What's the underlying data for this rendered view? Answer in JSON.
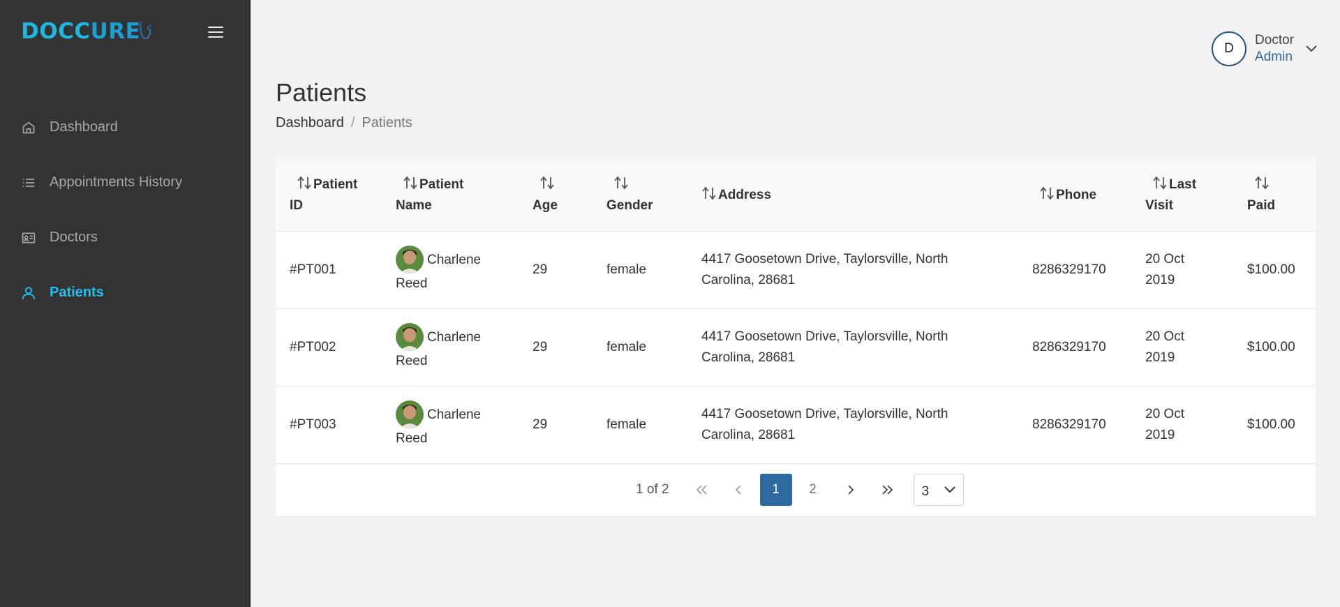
{
  "logo": {
    "text_a": "DOCC",
    "text_b": "URE"
  },
  "sidebar": {
    "items": [
      {
        "label": "Dashboard",
        "icon": "home-icon",
        "active": false
      },
      {
        "label": "Appointments History",
        "icon": "list-icon",
        "active": false
      },
      {
        "label": "Doctors",
        "icon": "id-card-icon",
        "active": false
      },
      {
        "label": "Patients",
        "icon": "user-icon",
        "active": true
      }
    ]
  },
  "header": {
    "user_initial": "D",
    "user_name": "Doctor",
    "user_role": "Admin"
  },
  "page": {
    "title": "Patients",
    "breadcrumb_home": "Dashboard",
    "breadcrumb_sep": "/",
    "breadcrumb_current": "Patients"
  },
  "table": {
    "columns": [
      {
        "line1": "Patient",
        "line2": "ID"
      },
      {
        "line1": "Patient",
        "line2": "Name"
      },
      {
        "line1": "",
        "line2": "Age"
      },
      {
        "line1": "",
        "line2": "Gender"
      },
      {
        "line1": "Address",
        "line2": ""
      },
      {
        "line1": "Phone",
        "line2": ""
      },
      {
        "line1": "Last",
        "line2": "Visit"
      },
      {
        "line1": "",
        "line2": "Paid"
      }
    ],
    "rows": [
      {
        "id": "#PT001",
        "name_first": "Charlene",
        "name_last": "Reed",
        "age": "29",
        "gender": "female",
        "address_1": "4417 Goosetown Drive, Taylorsville, North",
        "address_2": "Carolina, 28681",
        "phone": "8286329170",
        "visit_1": "20 Oct",
        "visit_2": "2019",
        "paid": "$100.00"
      },
      {
        "id": "#PT002",
        "name_first": "Charlene",
        "name_last": "Reed",
        "age": "29",
        "gender": "female",
        "address_1": "4417 Goosetown Drive, Taylorsville, North",
        "address_2": "Carolina, 28681",
        "phone": "8286329170",
        "visit_1": "20 Oct",
        "visit_2": "2019",
        "paid": "$100.00"
      },
      {
        "id": "#PT003",
        "name_first": "Charlene",
        "name_last": "Reed",
        "age": "29",
        "gender": "female",
        "address_1": "4417 Goosetown Drive, Taylorsville, North",
        "address_2": "Carolina, 28681",
        "phone": "8286329170",
        "visit_1": "20 Oct",
        "visit_2": "2019",
        "paid": "$100.00"
      }
    ]
  },
  "pagination": {
    "info": "1 of 2",
    "pages": [
      "1",
      "2"
    ],
    "current": "1",
    "page_size": "3"
  },
  "colors": {
    "accent": "#20c0f3",
    "sidebar_bg": "#333333",
    "primary": "#2c6aa0"
  }
}
